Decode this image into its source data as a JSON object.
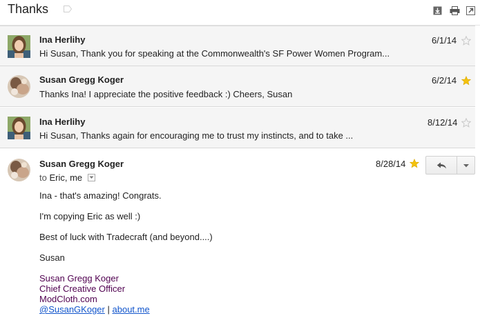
{
  "thread": {
    "subject": "Thanks"
  },
  "icons": {
    "label": "label-tag-icon",
    "download": "download-icon",
    "print": "print-icon",
    "popout": "new-window-icon",
    "star": "star-icon",
    "reply": "reply-icon",
    "more": "chevron-down-icon"
  },
  "colors": {
    "star_on": "#f4c20d",
    "star_off": "#c8c8c8",
    "signature": "#500050",
    "link": "#1155cc"
  },
  "messages": [
    {
      "sender": "Ina Herlihy",
      "date": "6/1/14",
      "starred": false,
      "snippet": "Hi Susan, Thank you for speaking at the Commonwealth's SF Power Women Program..."
    },
    {
      "sender": "Susan Gregg Koger",
      "date": "6/2/14",
      "starred": true,
      "snippet": "Thanks Ina! I appreciate the positive feedback :) Cheers, Susan"
    },
    {
      "sender": "Ina Herlihy",
      "date": "8/12/14",
      "starred": false,
      "snippet": "Hi Susan, Thanks again for encouraging me to trust my instincts, and to take ..."
    }
  ],
  "expanded": {
    "sender": "Susan Gregg Koger",
    "date": "8/28/14",
    "starred": true,
    "to_prefix": "to",
    "to_names": "Eric, me",
    "body": [
      "Ina - that's amazing! Congrats.",
      "I'm copying Eric as well :)",
      "Best of luck with Tradecraft (and beyond....)",
      "Susan"
    ],
    "signature": {
      "name": "Susan Gregg Koger",
      "title": "Chief Creative Officer",
      "company": "ModCloth.com",
      "twitter": "@SusanGKoger",
      "separator": "|",
      "site": "about.me"
    }
  }
}
